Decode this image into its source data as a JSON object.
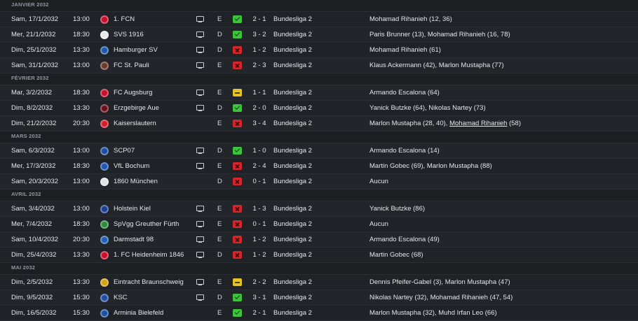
{
  "months": [
    {
      "label": "JANVIER 2032",
      "matches": [
        {
          "date": "Sam, 17/1/2032",
          "time": "13:00",
          "team": "1. FCN",
          "badge": "#c8102e",
          "tv": true,
          "venue": "E",
          "result": "V",
          "score": "2 - 1",
          "competition": "Bundesliga 2",
          "scorers": "Mohamad Rihanieh (12, 36)"
        },
        {
          "date": "Mer, 21/1/2032",
          "time": "18:30",
          "team": "SVS 1916",
          "badge": "#e8e8e8",
          "tv": true,
          "venue": "D",
          "result": "V",
          "score": "3 - 2",
          "competition": "Bundesliga 2",
          "scorers": "Paris Brunner (13), Mohamad Rihanieh (16, 78)"
        },
        {
          "date": "Dim, 25/1/2032",
          "time": "13:30",
          "team": "Hamburger SV",
          "badge": "#1f5aa6",
          "tv": true,
          "venue": "D",
          "result": "D",
          "score": "1 - 2",
          "competition": "Bundesliga 2",
          "scorers": "Mohamad Rihanieh (61)"
        },
        {
          "date": "Sam, 31/1/2032",
          "time": "13:00",
          "team": "FC St. Pauli",
          "badge": "#6b3a2a",
          "tv": true,
          "venue": "E",
          "result": "D",
          "score": "2 - 3",
          "competition": "Bundesliga 2",
          "scorers": "Klaus Ackermann (42), Marlon Mustapha (77)"
        }
      ]
    },
    {
      "label": "FÉVRIER 2032",
      "matches": [
        {
          "date": "Mar, 3/2/2032",
          "time": "18:30",
          "team": "FC Augsburg",
          "badge": "#c8102e",
          "tv": true,
          "venue": "E",
          "result": "N",
          "score": "1 - 1",
          "competition": "Bundesliga 2",
          "scorers": "Armando Escalona (64)"
        },
        {
          "date": "Dim, 8/2/2032",
          "time": "13:30",
          "team": "Erzgebirge Aue",
          "badge": "#6b0f1a",
          "tv": true,
          "venue": "D",
          "result": "V",
          "score": "2 - 0",
          "competition": "Bundesliga 2",
          "scorers": "Yanick Butzke (64), Nikolas Nartey (73)"
        },
        {
          "date": "Dim, 21/2/2032",
          "time": "20:30",
          "team": "Kaiserslautern",
          "badge": "#d0202a",
          "tv": false,
          "venue": "E",
          "result": "D",
          "score": "3 - 4",
          "competition": "Bundesliga 2",
          "scorers": "Marlon Mustapha (28, 40), ",
          "scorers_link": "Mohamad Rihanieh",
          "scorers_tail": " (58)"
        }
      ]
    },
    {
      "label": "MARS 2032",
      "matches": [
        {
          "date": "Sam, 6/3/2032",
          "time": "13:00",
          "team": "SCP07",
          "badge": "#1d4e9e",
          "tv": true,
          "venue": "D",
          "result": "V",
          "score": "1 - 0",
          "competition": "Bundesliga 2",
          "scorers": "Armando Escalona (14)"
        },
        {
          "date": "Mer, 17/3/2032",
          "time": "18:30",
          "team": "VfL Bochum",
          "badge": "#1f56b0",
          "tv": true,
          "venue": "E",
          "result": "D",
          "score": "2 - 4",
          "competition": "Bundesliga 2",
          "scorers": "Martin Gobec (69), Marlon Mustapha (88)"
        },
        {
          "date": "Sam, 20/3/2032",
          "time": "13:00",
          "team": "1860 München",
          "badge": "#dfe3e8",
          "tv": false,
          "venue": "D",
          "result": "D",
          "score": "0 - 1",
          "competition": "Bundesliga 2",
          "scorers": "Aucun"
        }
      ]
    },
    {
      "label": "AVRIL 2032",
      "matches": [
        {
          "date": "Sam, 3/4/2032",
          "time": "13:00",
          "team": "Holstein Kiel",
          "badge": "#1d3f8f",
          "tv": true,
          "venue": "E",
          "result": "D",
          "score": "1 - 3",
          "competition": "Bundesliga 2",
          "scorers": "Yanick Butzke (86)"
        },
        {
          "date": "Mer, 7/4/2032",
          "time": "18:30",
          "team": "SpVgg Greuther Fürth",
          "badge": "#2e8b3e",
          "tv": true,
          "venue": "E",
          "result": "D",
          "score": "0 - 1",
          "competition": "Bundesliga 2",
          "scorers": "Aucun"
        },
        {
          "date": "Sam, 10/4/2032",
          "time": "20:30",
          "team": "Darmstadt 98",
          "badge": "#2160b3",
          "tv": true,
          "venue": "E",
          "result": "D",
          "score": "1 - 2",
          "competition": "Bundesliga 2",
          "scorers": "Armando Escalona (49)"
        },
        {
          "date": "Dim, 25/4/2032",
          "time": "13:30",
          "team": "1. FC Heidenheim 1846",
          "badge": "#c8102e",
          "tv": true,
          "venue": "D",
          "result": "D",
          "score": "1 - 2",
          "competition": "Bundesliga 2",
          "scorers": "Martin Gobec (68)"
        }
      ]
    },
    {
      "label": "MAI 2032",
      "matches": [
        {
          "date": "Dim, 2/5/2032",
          "time": "13:30",
          "team": "Eintracht Braunschweig",
          "badge": "#d4a017",
          "tv": true,
          "venue": "E",
          "result": "N",
          "score": "2 - 2",
          "competition": "Bundesliga 2",
          "scorers": "Dennis Pfeifer-Gabel (3), Marlon Mustapha (47)"
        },
        {
          "date": "Dim, 9/5/2032",
          "time": "15:30",
          "team": "KSC",
          "badge": "#1f4fa0",
          "tv": true,
          "venue": "D",
          "result": "V",
          "score": "3 - 1",
          "competition": "Bundesliga 2",
          "scorers": "Nikolas Nartey (32), Mohamad Rihanieh (47, 54)"
        },
        {
          "date": "Dim, 16/5/2032",
          "time": "15:30",
          "team": "Arminia Bielefeld",
          "badge": "#1f4fa0",
          "tv": false,
          "venue": "E",
          "result": "V",
          "score": "2 - 1",
          "competition": "Bundesliga 2",
          "scorers": "Marlon Mustapha (32), Muhd Irfan Leo (66)"
        }
      ]
    }
  ]
}
